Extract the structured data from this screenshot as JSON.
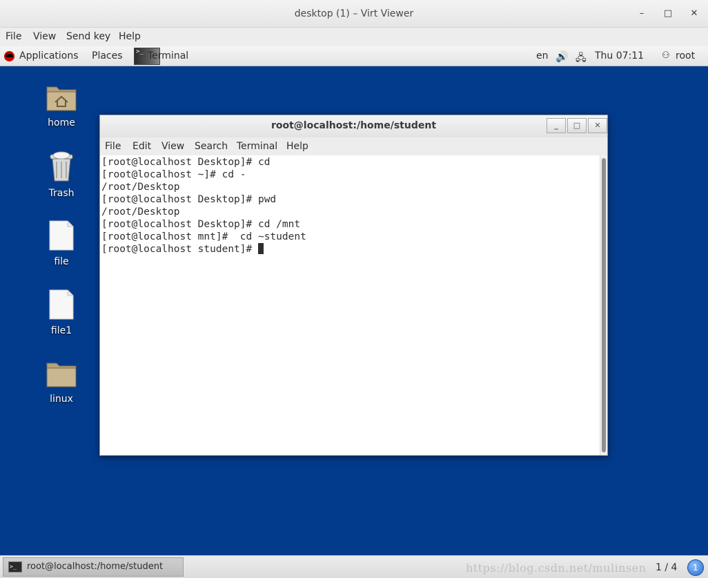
{
  "outer_window": {
    "title": "desktop (1) – Virt Viewer",
    "controls": {
      "minimize": "–",
      "maximize": "□",
      "close": "✕"
    },
    "menu": [
      "File",
      "View",
      "Send key",
      "Help"
    ]
  },
  "topbar": {
    "applications": "Applications",
    "places": "Places",
    "active_app": "Terminal",
    "input_lang": "en",
    "clock": "Thu 07:11",
    "user": "root",
    "icons": {
      "volume": "speaker-icon",
      "network": "network-icon",
      "user": "user-icon"
    }
  },
  "desktop": {
    "icons": [
      {
        "label": "home",
        "type": "folder-home-icon"
      },
      {
        "label": "Trash",
        "type": "trash-icon"
      },
      {
        "label": "file",
        "type": "file-icon"
      },
      {
        "label": "file1",
        "type": "file-icon"
      },
      {
        "label": "linux",
        "type": "folder-icon"
      }
    ]
  },
  "terminal": {
    "title": "root@localhost:/home/student",
    "controls": {
      "minimize": "_",
      "maximize": "□",
      "close": "✕"
    },
    "menu": [
      "File",
      "Edit",
      "View",
      "Search",
      "Terminal",
      "Help"
    ],
    "lines": [
      "[root@localhost Desktop]# cd",
      "[root@localhost ~]# cd -",
      "/root/Desktop",
      "[root@localhost Desktop]# pwd",
      "/root/Desktop",
      "[root@localhost Desktop]# cd /mnt",
      "[root@localhost mnt]#  cd ~student",
      "[root@localhost student]# "
    ]
  },
  "taskbar": {
    "item_label": "root@localhost:/home/student",
    "watermark": "https://blog.csdn.net/mulinsen",
    "workspace": "1 / 4",
    "workspace_badge": "1"
  },
  "colors": {
    "desktop_bg": "#033b8c",
    "panel_bg": "#ededed",
    "terminal_text": "#2e2e2e"
  }
}
